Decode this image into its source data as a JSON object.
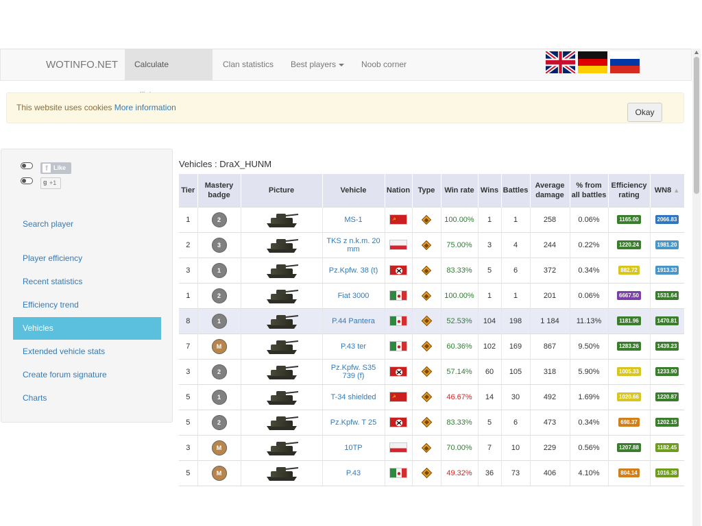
{
  "navbar": {
    "brand": "WOTINFO.NET",
    "items": [
      {
        "label": "Calculate efficiency",
        "active": true
      },
      {
        "label": "Clan statistics",
        "active": false
      },
      {
        "label": "Best players",
        "active": false,
        "dropdown": true
      },
      {
        "label": "Noob corner",
        "active": false
      }
    ],
    "languages": [
      "english-flag",
      "german-flag",
      "russian-flag"
    ]
  },
  "cookie": {
    "text": "This website uses cookies",
    "link": "More information",
    "button": "Okay"
  },
  "social": {
    "fb_like": "Like",
    "gplus": "+1",
    "gplus_g": "g"
  },
  "sidebar": {
    "items": [
      {
        "label": "Search player",
        "active": false
      },
      {
        "label": "Player efficiency",
        "active": false
      },
      {
        "label": "Recent statistics",
        "active": false
      },
      {
        "label": "Efficiency trend",
        "active": false
      },
      {
        "label": "Vehicles",
        "active": true
      },
      {
        "label": "Extended vehicle stats",
        "active": false
      },
      {
        "label": "Create forum signature",
        "active": false
      },
      {
        "label": "Charts",
        "active": false
      }
    ]
  },
  "main": {
    "title": "Vehicles : DraX_HUNM",
    "columns": [
      "Tier",
      "Mastery badge",
      "Picture",
      "Vehicle",
      "Nation",
      "Type",
      "Win rate",
      "Wins",
      "Battles",
      "Average damage",
      "% from all battles",
      "Efficiency rating",
      "WN8"
    ],
    "sort_indicator": "▲",
    "rows": [
      {
        "tier": "1",
        "mastery": "2",
        "vehicle": "MS-1",
        "nation": "ussr",
        "type": "light",
        "win_rate": "100.00%",
        "wr_color": "green",
        "wins": "1",
        "battles": "1",
        "avg_damage": "258",
        "pct": "0.06%",
        "eff": "1165.00",
        "eff_color": "#3a7d2c",
        "wn8": "2066.83",
        "wn8_color": "#2f75c0"
      },
      {
        "tier": "2",
        "mastery": "3",
        "vehicle": "TKS z n.k.m. 20 mm",
        "nation": "poland",
        "type": "light",
        "win_rate": "75.00%",
        "wr_color": "green",
        "wins": "3",
        "battles": "4",
        "avg_damage": "244",
        "pct": "0.22%",
        "eff": "1220.24",
        "eff_color": "#3a7d2c",
        "wn8": "1981.20",
        "wn8_color": "#4a95c8"
      },
      {
        "tier": "3",
        "mastery": "1",
        "vehicle": "Pz.Kpfw. 38 (t)",
        "nation": "germany",
        "type": "light",
        "win_rate": "83.33%",
        "wr_color": "green",
        "wins": "5",
        "battles": "6",
        "avg_damage": "372",
        "pct": "0.34%",
        "eff": "882.72",
        "eff_color": "#d8c522",
        "wn8": "1913.33",
        "wn8_color": "#4a95c8"
      },
      {
        "tier": "1",
        "mastery": "2",
        "vehicle": "Fiat 3000",
        "nation": "italy",
        "type": "light",
        "win_rate": "100.00%",
        "wr_color": "green",
        "wins": "1",
        "battles": "1",
        "avg_damage": "201",
        "pct": "0.06%",
        "eff": "6667.50",
        "eff_color": "#7b3fa8",
        "wn8": "1531.64",
        "wn8_color": "#3a7d2c"
      },
      {
        "tier": "8",
        "mastery": "1",
        "vehicle": "P.44 Pantera",
        "nation": "italy",
        "type": "medium",
        "win_rate": "52.53%",
        "wr_color": "green",
        "wins": "104",
        "battles": "198",
        "avg_damage": "1 184",
        "pct": "11.13%",
        "eff": "1181.96",
        "eff_color": "#3a7d2c",
        "wn8": "1470.81",
        "wn8_color": "#3a7d2c",
        "highlight": true
      },
      {
        "tier": "7",
        "mastery": "M",
        "vehicle": "P.43 ter",
        "nation": "italy",
        "type": "medium",
        "win_rate": "60.36%",
        "wr_color": "green",
        "wins": "102",
        "battles": "169",
        "avg_damage": "867",
        "pct": "9.50%",
        "eff": "1283.26",
        "eff_color": "#3a7d2c",
        "wn8": "1439.23",
        "wn8_color": "#3a7d2c"
      },
      {
        "tier": "3",
        "mastery": "2",
        "vehicle": "Pz.Kpfw. S35 739 (f)",
        "nation": "germany",
        "type": "medium",
        "win_rate": "57.14%",
        "wr_color": "green",
        "wins": "60",
        "battles": "105",
        "avg_damage": "318",
        "pct": "5.90%",
        "eff": "1005.33",
        "eff_color": "#d8c522",
        "wn8": "1233.90",
        "wn8_color": "#3a7d2c"
      },
      {
        "tier": "5",
        "mastery": "1",
        "vehicle": "T-34 shielded",
        "nation": "ussr",
        "type": "medium",
        "win_rate": "46.67%",
        "wr_color": "red",
        "wins": "14",
        "battles": "30",
        "avg_damage": "492",
        "pct": "1.69%",
        "eff": "1020.66",
        "eff_color": "#d8c522",
        "wn8": "1220.87",
        "wn8_color": "#3a7d2c"
      },
      {
        "tier": "5",
        "mastery": "2",
        "vehicle": "Pz.Kpfw. T 25",
        "nation": "germany",
        "type": "medium",
        "win_rate": "83.33%",
        "wr_color": "green",
        "wins": "5",
        "battles": "6",
        "avg_damage": "473",
        "pct": "0.34%",
        "eff": "698.37",
        "eff_color": "#d17e1c",
        "wn8": "1202.15",
        "wn8_color": "#3a7d2c"
      },
      {
        "tier": "3",
        "mastery": "M",
        "vehicle": "10TP",
        "nation": "poland",
        "type": "light",
        "win_rate": "70.00%",
        "wr_color": "green",
        "wins": "7",
        "battles": "10",
        "avg_damage": "229",
        "pct": "0.56%",
        "eff": "1207.88",
        "eff_color": "#3a7d2c",
        "wn8": "1182.45",
        "wn8_color": "#6e9c1e"
      },
      {
        "tier": "5",
        "mastery": "M",
        "vehicle": "P.43",
        "nation": "italy",
        "type": "medium",
        "win_rate": "49.32%",
        "wr_color": "red",
        "wins": "36",
        "battles": "73",
        "avg_damage": "406",
        "pct": "4.10%",
        "eff": "804.14",
        "eff_color": "#d17e1c",
        "wn8": "1016.38",
        "wn8_color": "#6e9c1e"
      }
    ]
  }
}
